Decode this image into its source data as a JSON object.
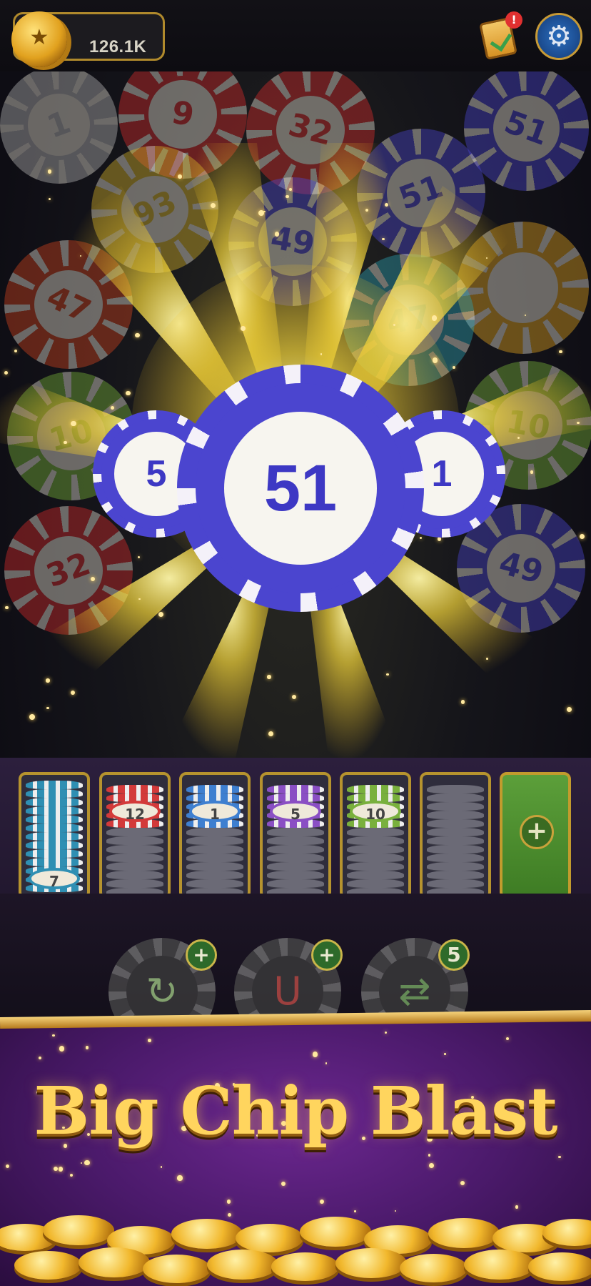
{
  "header": {
    "coin_value": "126.1K",
    "task_badge": "!"
  },
  "background_chips": [
    {
      "label": "1",
      "color": "#b6b6b6"
    },
    {
      "label": "9",
      "color": "#d82b2b"
    },
    {
      "label": "32",
      "color": "#d82b2b"
    },
    {
      "label": "51",
      "color": "#4b45cf"
    },
    {
      "label": "93",
      "color": "#d8b52a"
    },
    {
      "label": "51",
      "color": "#4b45cf"
    },
    {
      "label": "49",
      "color": "#4b45cf"
    },
    {
      "label": "47",
      "color": "#d2441e"
    },
    {
      "label": "",
      "color": "#e4a51f"
    },
    {
      "label": "47",
      "color": "#2a9fb0"
    },
    {
      "label": "10",
      "color": "#7ab63a"
    },
    {
      "label": "10",
      "color": "#7ab63a"
    },
    {
      "label": "32",
      "color": "#d82b2b"
    },
    {
      "label": "49",
      "color": "#4b45cf"
    }
  ],
  "featured_chips": [
    {
      "label": "5",
      "role": "left"
    },
    {
      "label": "51",
      "role": "center"
    },
    {
      "label": "1",
      "role": "right"
    }
  ],
  "tray": {
    "slots": [
      {
        "top_label": "7",
        "color": "#2f8fb3"
      },
      {
        "top_label": "12",
        "color": "#d33a3a"
      },
      {
        "top_label": "1",
        "color": "#3e7fd0"
      },
      {
        "top_label": "5",
        "color": "#8a4fc4"
      },
      {
        "top_label": "10",
        "color": "#79b03d"
      },
      {
        "top_label": "",
        "color": "#6f6f7a"
      }
    ],
    "add_slot_label": "+"
  },
  "boosters": [
    {
      "icon": "undo-arrow-icon",
      "glyph": "↻",
      "badge": "+"
    },
    {
      "icon": "magnet-icon",
      "glyph": "U",
      "badge": "+"
    },
    {
      "icon": "shuffle-icon",
      "glyph": "⇄",
      "badge": "5"
    }
  ],
  "banner": {
    "title": "Big Chip Blast"
  },
  "colors": {
    "chip_blue": "#4b45cf",
    "gold": "#ffd55e",
    "banner_purple": "#4b1a6b"
  }
}
